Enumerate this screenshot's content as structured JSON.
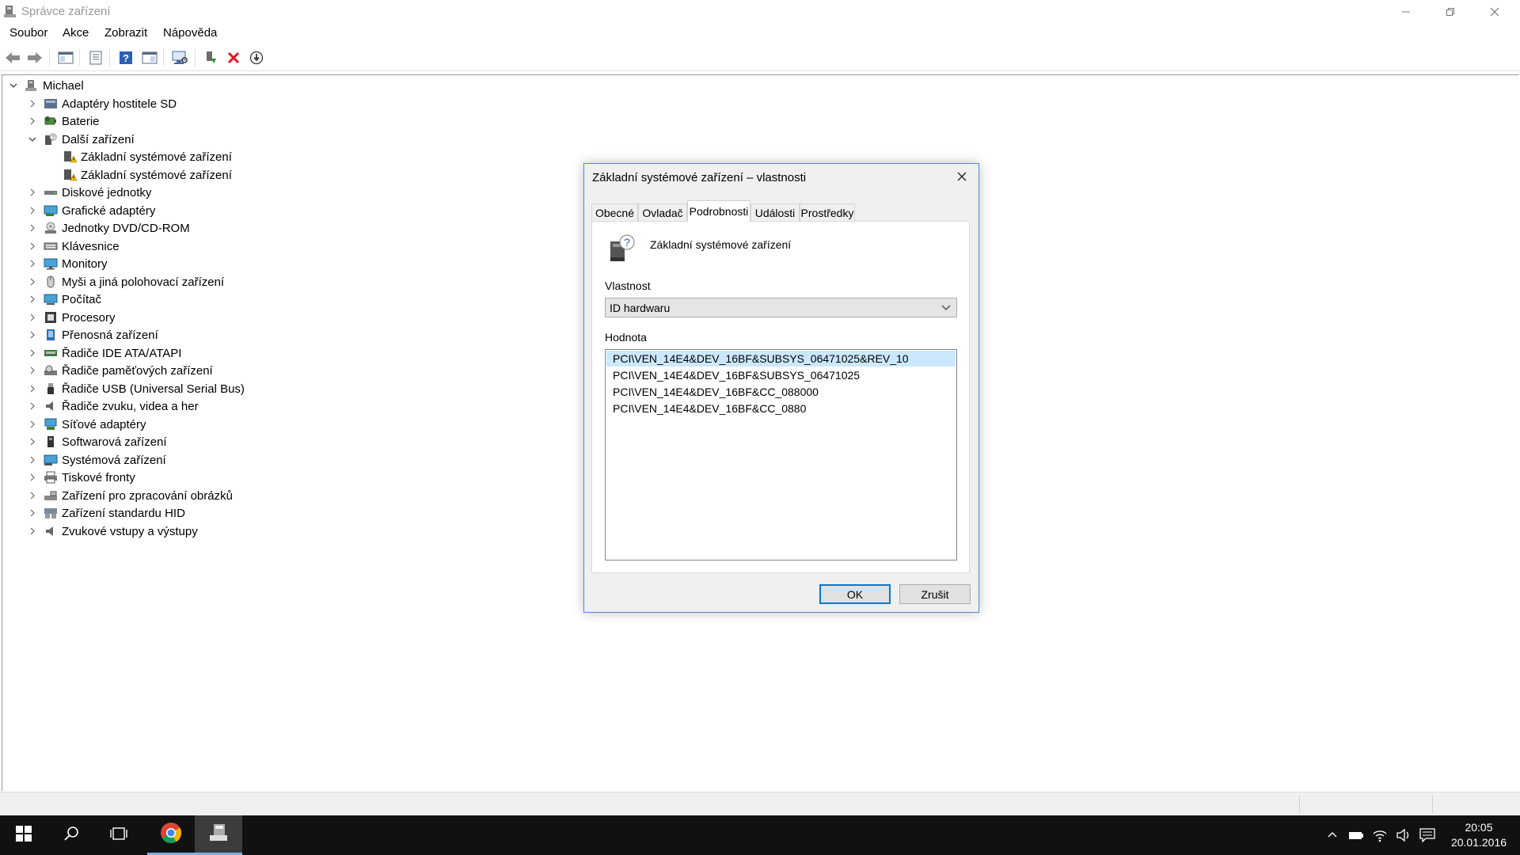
{
  "window": {
    "title": "Správce zařízení"
  },
  "menu": [
    "Soubor",
    "Akce",
    "Zobrazit",
    "Nápověda"
  ],
  "tree": {
    "root": "Michael",
    "items": [
      {
        "label": "Adaptéry hostitele SD",
        "icon": "sd-card-icon",
        "expanded": false
      },
      {
        "label": "Baterie",
        "icon": "battery-icon",
        "expanded": false
      },
      {
        "label": "Další zařízení",
        "icon": "unknown-device-icon",
        "expanded": true,
        "children": [
          {
            "label": "Základní systémové zařízení",
            "icon": "warning-device-icon"
          },
          {
            "label": "Základní systémové zařízení",
            "icon": "warning-device-icon"
          }
        ]
      },
      {
        "label": "Diskové jednotky",
        "icon": "disk-drive-icon",
        "expanded": false
      },
      {
        "label": "Grafické adaptéry",
        "icon": "display-adapter-icon",
        "expanded": false
      },
      {
        "label": "Jednotky DVD/CD-ROM",
        "icon": "dvd-drive-icon",
        "expanded": false
      },
      {
        "label": "Klávesnice",
        "icon": "keyboard-icon",
        "expanded": false
      },
      {
        "label": "Monitory",
        "icon": "monitor-icon",
        "expanded": false
      },
      {
        "label": "Myši a jiná polohovací zařízení",
        "icon": "mouse-icon",
        "expanded": false
      },
      {
        "label": "Počítač",
        "icon": "computer-icon",
        "expanded": false
      },
      {
        "label": "Procesory",
        "icon": "processor-icon",
        "expanded": false
      },
      {
        "label": "Přenosná zařízení",
        "icon": "portable-device-icon",
        "expanded": false
      },
      {
        "label": "Řadiče IDE ATA/ATAPI",
        "icon": "ide-controller-icon",
        "expanded": false
      },
      {
        "label": "Řadiče paměťových zařízení",
        "icon": "storage-controller-icon",
        "expanded": false
      },
      {
        "label": "Řadiče USB (Universal Serial Bus)",
        "icon": "usb-icon",
        "expanded": false
      },
      {
        "label": "Řadiče zvuku, videa a her",
        "icon": "sound-icon",
        "expanded": false
      },
      {
        "label": "Síťové adaptéry",
        "icon": "network-adapter-icon",
        "expanded": false
      },
      {
        "label": "Softwarová zařízení",
        "icon": "software-device-icon",
        "expanded": false
      },
      {
        "label": "Systémová zařízení",
        "icon": "system-device-icon",
        "expanded": false
      },
      {
        "label": "Tiskové fronty",
        "icon": "printer-icon",
        "expanded": false
      },
      {
        "label": "Zařízení pro zpracování obrázků",
        "icon": "imaging-device-icon",
        "expanded": false
      },
      {
        "label": "Zařízení standardu HID",
        "icon": "hid-icon",
        "expanded": false
      },
      {
        "label": "Zvukové vstupy a výstupy",
        "icon": "audio-io-icon",
        "expanded": false
      }
    ]
  },
  "dialog": {
    "title": "Základní systémové zařízení – vlastnosti",
    "tabs": [
      "Obecné",
      "Ovladač",
      "Podrobnosti",
      "Události",
      "Prostředky"
    ],
    "active_tab": "Podrobnosti",
    "device_name": "Základní systémové zařízení",
    "property_label": "Vlastnost",
    "property_value": "ID hardwaru",
    "value_label": "Hodnota",
    "values": [
      "PCI\\VEN_14E4&DEV_16BF&SUBSYS_06471025&REV_10",
      "PCI\\VEN_14E4&DEV_16BF&SUBSYS_06471025",
      "PCI\\VEN_14E4&DEV_16BF&CC_088000",
      "PCI\\VEN_14E4&DEV_16BF&CC_0880"
    ],
    "ok_label": "OK",
    "cancel_label": "Zrušit"
  },
  "taskbar": {
    "time": "20:05",
    "date": "20.01.2016"
  },
  "colors": {
    "selection": "#cce8ff",
    "accent": "#0078d7",
    "taskbar": "#111111",
    "delete": "#e81123"
  }
}
